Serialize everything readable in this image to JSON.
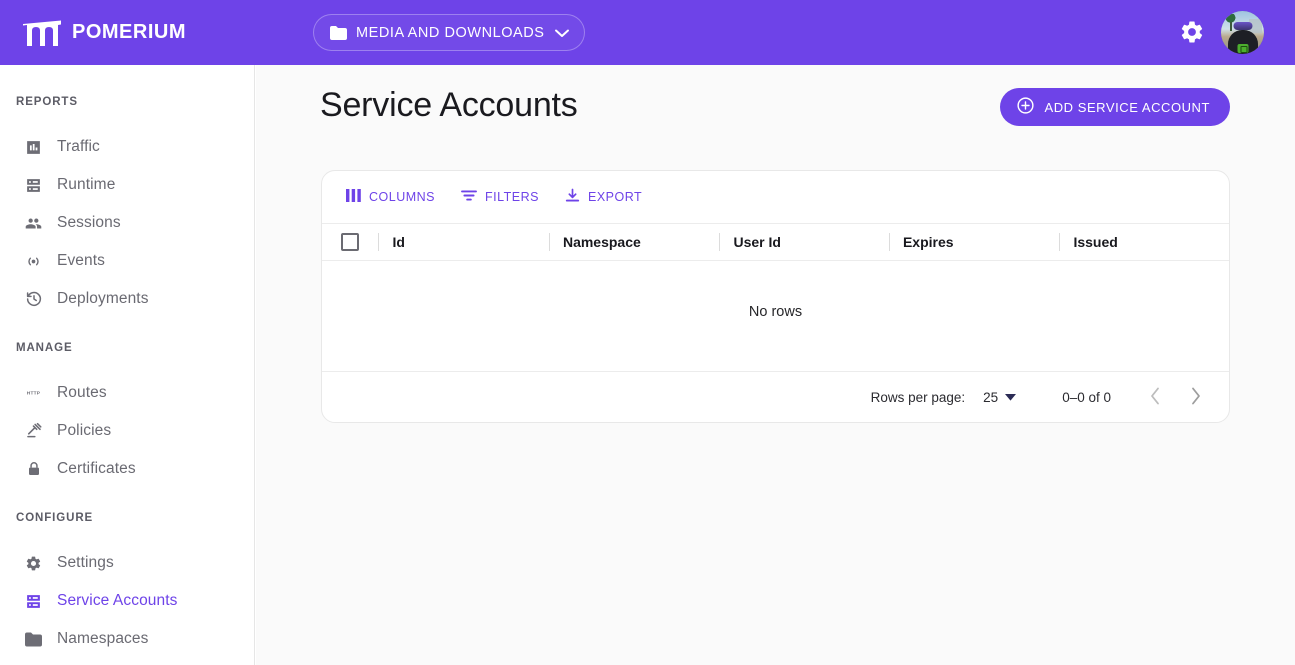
{
  "topbar": {
    "brand_name": "POMERIUM",
    "logo_icon": "pomerium-arch-logo",
    "namespace_selector": {
      "icon": "folder-icon",
      "label": "MEDIA AND DOWNLOADS",
      "chevron_icon": "chevron-down-icon"
    },
    "settings_icon": "gear-icon",
    "avatar_icon": "user-avatar",
    "background_color": "#6E43E8"
  },
  "sidebar": {
    "sections": [
      {
        "title": "REPORTS",
        "items": [
          {
            "label": "Traffic",
            "icon": "bar-chart-icon",
            "active": false
          },
          {
            "label": "Runtime",
            "icon": "server-icon",
            "active": false
          },
          {
            "label": "Sessions",
            "icon": "people-icon",
            "active": false
          },
          {
            "label": "Events",
            "icon": "broadcast-icon",
            "active": false
          },
          {
            "label": "Deployments",
            "icon": "history-icon",
            "active": false
          }
        ]
      },
      {
        "title": "MANAGE",
        "items": [
          {
            "label": "Routes",
            "icon": "http-icon",
            "active": false
          },
          {
            "label": "Policies",
            "icon": "gavel-icon",
            "active": false
          },
          {
            "label": "Certificates",
            "icon": "lock-icon",
            "active": false
          }
        ]
      },
      {
        "title": "CONFIGURE",
        "items": [
          {
            "label": "Settings",
            "icon": "gear-icon",
            "active": false
          },
          {
            "label": "Service Accounts",
            "icon": "server-icon",
            "active": true
          },
          {
            "label": "Namespaces",
            "icon": "folder-icon",
            "active": false
          }
        ]
      }
    ],
    "active_color": "#6E43E8",
    "inactive_color": "#6a6a72"
  },
  "main": {
    "page_title": "Service Accounts",
    "add_button": {
      "label": "ADD SERVICE ACCOUNT",
      "icon": "plus-circle-icon"
    },
    "toolbar": [
      {
        "label": "COLUMNS",
        "icon": "columns-icon"
      },
      {
        "label": "FILTERS",
        "icon": "filter-icon"
      },
      {
        "label": "EXPORT",
        "icon": "download-icon"
      }
    ],
    "table": {
      "select_all_checkbox": "unchecked",
      "columns": [
        "Id",
        "Namespace",
        "User Id",
        "Expires",
        "Issued"
      ],
      "rows": [],
      "empty_message": "No rows"
    },
    "footer": {
      "rows_per_page_label": "Rows per page:",
      "rows_per_page_value": "25",
      "dropdown_icon": "caret-down-icon",
      "range_label": "0–0 of 0",
      "prev_icon": "chevron-left-icon",
      "next_icon": "chevron-right-icon"
    },
    "accent_color": "#6E43E8",
    "background_color": "#fafafa"
  }
}
